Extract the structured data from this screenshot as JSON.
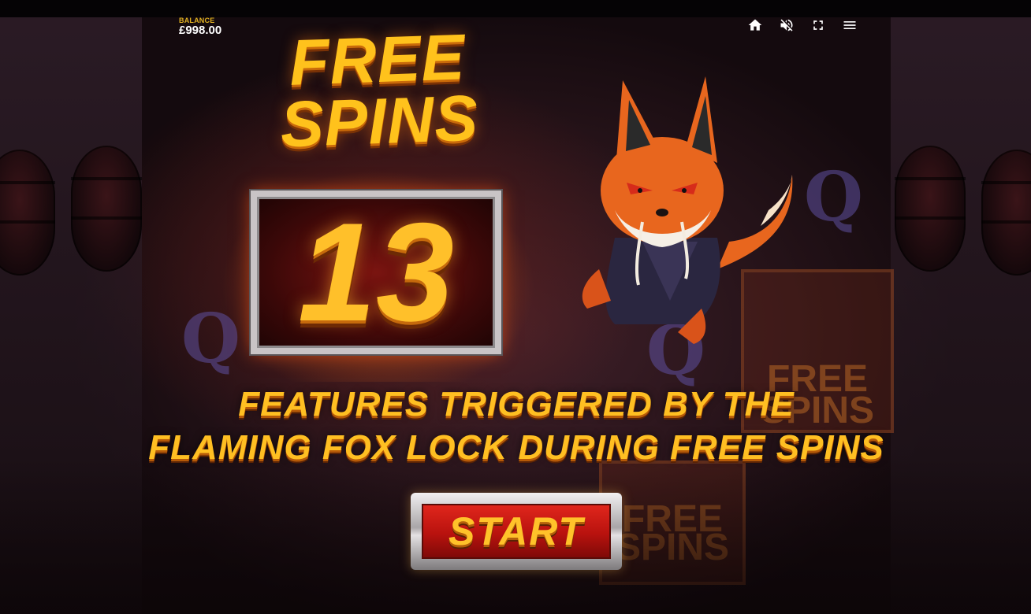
{
  "hud": {
    "balance_label": "BALANCE",
    "balance_value": "£998.00",
    "buttons": [
      {
        "name": "home",
        "icon": "home-icon"
      },
      {
        "name": "sound",
        "icon": "sound-muted-icon"
      },
      {
        "name": "fullscreen",
        "icon": "fullscreen-icon"
      },
      {
        "name": "menu",
        "icon": "hamburger-menu-icon"
      }
    ]
  },
  "feature_popup": {
    "title_line1": "FREE",
    "title_line2": "SPINS",
    "count": "13",
    "description_line1": "FEATURES TRIGGERED BY THE",
    "description_line2": "FLAMING FOX LOCK DURING FREE SPINS",
    "start_label": "START"
  },
  "background_symbols": {
    "ghost_card_text_1": "FREE",
    "ghost_card_text_2": "SPINS"
  },
  "colors": {
    "gold": "#ffc21c",
    "red": "#c8160f",
    "silver": "#c9c4c6",
    "balance_label": "#e0b020"
  }
}
